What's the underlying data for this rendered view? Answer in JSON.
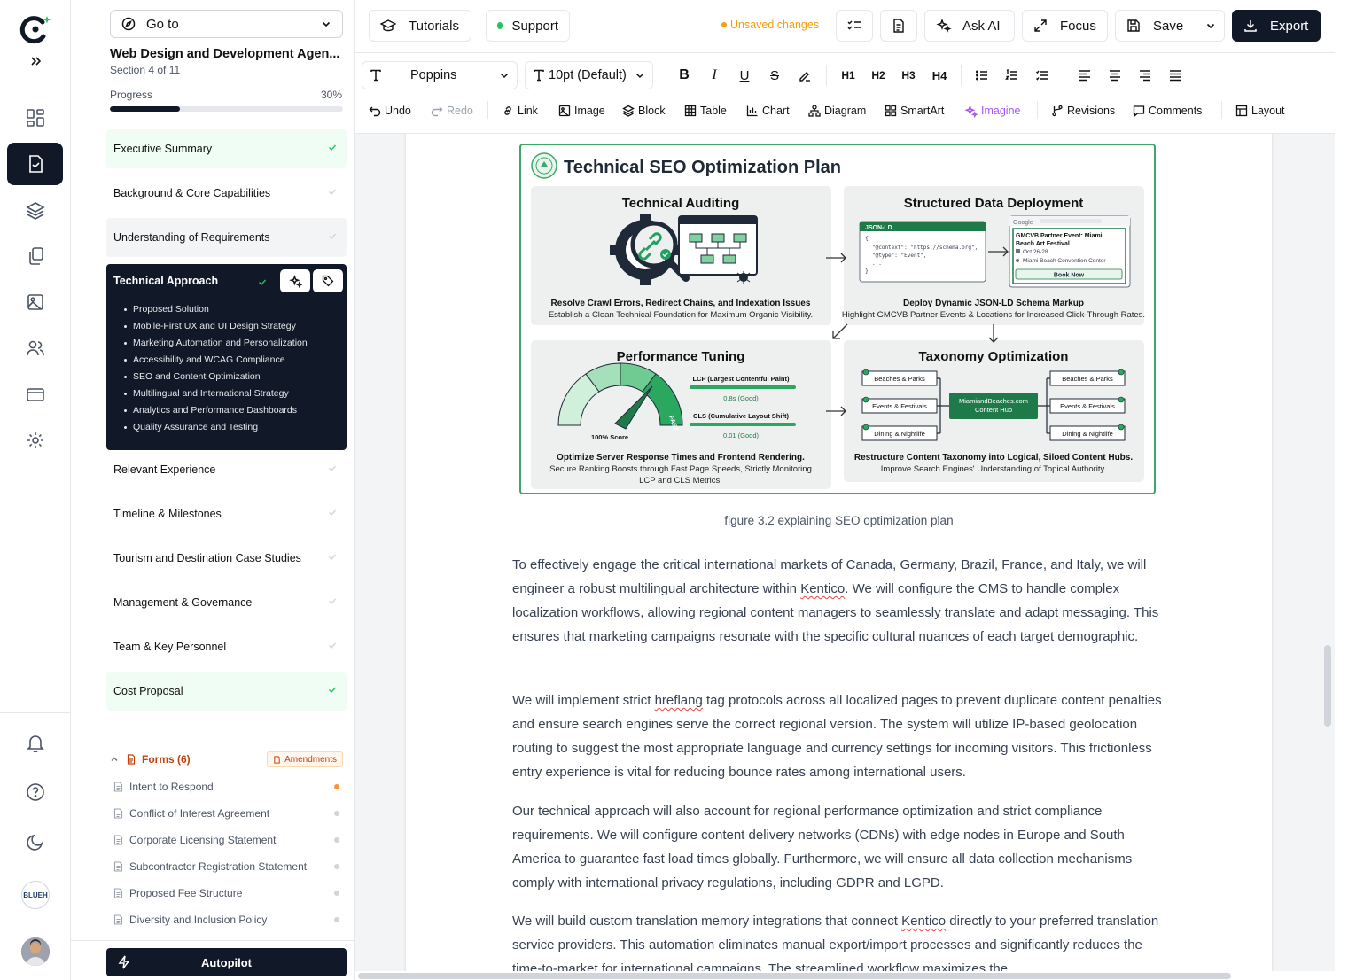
{
  "topbar": {
    "tutorials": "Tutorials",
    "support": "Support",
    "unsaved": "Unsaved changes",
    "ask_ai": "Ask AI",
    "focus": "Focus",
    "save": "Save",
    "export": "Export"
  },
  "sidebar": {
    "goto": "Go to",
    "doc_title": "Web Design and Development Agen...",
    "section_info": "Section 4 of 11",
    "progress_label": "Progress",
    "progress_pct": "30%",
    "progress_value": 0.3,
    "sections": [
      {
        "label": "Executive Summary",
        "state": "done"
      },
      {
        "label": "Background & Core Capabilities",
        "state": "pending"
      },
      {
        "label": "Understanding of Requirements",
        "state": "gray"
      },
      {
        "label": "Technical Approach",
        "state": "active"
      },
      {
        "label": "Relevant Experience",
        "state": "pending"
      },
      {
        "label": "Timeline & Milestones",
        "state": "pending"
      },
      {
        "label": "Tourism and Destination Case Studies",
        "state": "pending"
      },
      {
        "label": "Management & Governance",
        "state": "pending"
      },
      {
        "label": "Team & Key Personnel",
        "state": "pending"
      },
      {
        "label": "Cost Proposal",
        "state": "done"
      }
    ],
    "active_subsections": [
      "Proposed Solution",
      "Mobile-First UX and UI Design Strategy",
      "Marketing Automation and Personalization",
      "Accessibility and WCAG Compliance",
      "SEO and Content Optimization",
      "Multilingual and International Strategy",
      "Analytics and Performance Dashboards",
      "Quality Assurance and Testing"
    ],
    "forms_title": "Forms (6)",
    "amendments": "Amendments",
    "forms": [
      {
        "label": "Intent to Respond",
        "status": "orange"
      },
      {
        "label": "Conflict of Interest Agreement",
        "status": "gray"
      },
      {
        "label": "Corporate Licensing Statement",
        "status": "gray"
      },
      {
        "label": "Subcontractor Registration Statement",
        "status": "gray"
      },
      {
        "label": "Proposed Fee Structure",
        "status": "gray"
      },
      {
        "label": "Diversity and Inclusion Policy",
        "status": "gray"
      }
    ],
    "autopilot": "Autopilot"
  },
  "rail": {
    "avatar_text": "BLUEH"
  },
  "toolbar": {
    "font": "Poppins",
    "size": "10pt (Default)",
    "h1": "H1",
    "h2": "H2",
    "h3": "H3",
    "h4": "H4",
    "undo": "Undo",
    "redo": "Redo",
    "link": "Link",
    "image": "Image",
    "block": "Block",
    "table": "Table",
    "chart": "Chart",
    "diagram": "Diagram",
    "smartart": "SmartArt",
    "imagine": "Imagine",
    "revisions": "Revisions",
    "comments": "Comments",
    "layout": "Layout"
  },
  "figure": {
    "title": "Technical SEO Optimization Plan",
    "q1": {
      "title": "Technical Auditing",
      "bold": "Resolve Crawl Errors, Redirect Chains, and Indexation Issues",
      "sub": "Establish a Clean Technical Foundation for Maximum Organic Visibility."
    },
    "q2": {
      "title": "Structured Data Deployment",
      "code_label": "JSON-LD",
      "code1": "{",
      "code2": "\"@context\": \"https://schema.org\",",
      "code3": "\"@type\": \"Event\",",
      "code4": "...",
      "code5": "}",
      "google": "Google",
      "event1": "GMCVB Partner Event: Miami",
      "event2": "Beach Art Festival",
      "date": "Oct 26-28",
      "venue": "Miami Beach Convention Center",
      "book": "Book Now",
      "bold": "Deploy Dynamic JSON-LD Schema Markup",
      "sub": "Highlight GMCVB Partner Events & Locations for Increased Click-Through Rates."
    },
    "q3": {
      "title": "Performance Tuning",
      "score": "100% Score",
      "fast": "FAST",
      "lcp": "LCP (Largest Contentful Paint)",
      "lcp_val": "0.8s (Good)",
      "cls": "CLS (Cumulative Layout Shift)",
      "cls_val": "0.01 (Good)",
      "bold": "Optimize Server Response Times and Frontend Rendering.",
      "sub1": "Secure Ranking Boosts through Fast Page Speeds, Strictly Monitoring",
      "sub2": "LCP and CLS Metrics."
    },
    "q4": {
      "title": "Taxonomy Optimization",
      "hub1": "MiamiandBeaches.com",
      "hub2": "Content Hub",
      "n1": "Beaches & Parks",
      "n2": "Events & Festivals",
      "n3": "Dining & Nightlife",
      "bold": "Restructure Content Taxonomy into Logical, Siloed Content Hubs.",
      "sub": "Improve Search Engines' Understanding of Topical Authority."
    }
  },
  "document": {
    "caption": "figure 3.2 explaining SEO optimization plan",
    "p1a": "To effectively engage the critical international markets of Canada, Germany, Brazil, France, and Italy, we will engineer a robust multilingual architecture within ",
    "kentico": "Kentico",
    "p1b": ". We will configure the CMS to handle complex localization workflows, allowing regional content managers to seamlessly translate and adapt messaging. This ensures that marketing campaigns resonate with the specific cultural nuances of each target demographic.",
    "p2a": "We will implement strict ",
    "hreflang": "hreflang",
    "p2b": " tag protocols across all localized pages to prevent duplicate content penalties and ensure search engines serve the correct regional version. The system will utilize IP-based geolocation routing to suggest the most appropriate language and currency settings for incoming visitors. This frictionless entry experience is vital for reducing bounce rates among international users.",
    "p3": "Our technical approach will also account for regional performance optimization and strict compliance requirements. We will configure content delivery networks (CDNs) with edge nodes in Europe and South America to guarantee fast load times globally. Furthermore, we will ensure all data collection mechanisms comply with international privacy regulations, including GDPR and LGPD.",
    "p4a": "We will build custom translation memory integrations that connect ",
    "p4b": " directly to your preferred translation service providers. This automation eliminates manual export/import processes and significantly reduces the time-to-market for international campaigns. The streamlined workflow maximizes the"
  }
}
